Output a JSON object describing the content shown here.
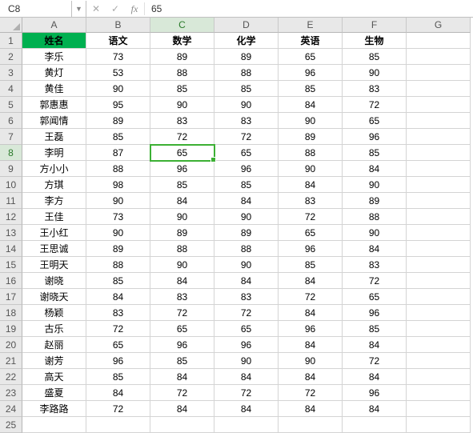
{
  "formula_bar": {
    "name_box": "C8",
    "cancel": "✕",
    "confirm": "✓",
    "fx": "fx",
    "value": "65"
  },
  "columns": [
    "A",
    "B",
    "C",
    "D",
    "E",
    "F",
    "G"
  ],
  "active_col_index": 2,
  "active_row_index": 7,
  "selected_cell": {
    "row": 7,
    "col": 2
  },
  "headers": [
    "姓名",
    "语文",
    "数学",
    "化学",
    "英语",
    "生物"
  ],
  "rows": [
    [
      "李乐",
      "73",
      "89",
      "89",
      "65",
      "85"
    ],
    [
      "黄灯",
      "53",
      "88",
      "88",
      "96",
      "90"
    ],
    [
      "黄佳",
      "90",
      "85",
      "85",
      "85",
      "83"
    ],
    [
      "郭惠惠",
      "95",
      "90",
      "90",
      "84",
      "72"
    ],
    [
      "郭闻情",
      "89",
      "83",
      "83",
      "90",
      "65"
    ],
    [
      "王磊",
      "85",
      "72",
      "72",
      "89",
      "96"
    ],
    [
      "李明",
      "87",
      "65",
      "65",
      "88",
      "85"
    ],
    [
      "方小小",
      "88",
      "96",
      "96",
      "90",
      "84"
    ],
    [
      "方琪",
      "98",
      "85",
      "85",
      "84",
      "90"
    ],
    [
      "李方",
      "90",
      "84",
      "84",
      "83",
      "89"
    ],
    [
      "王佳",
      "73",
      "90",
      "90",
      "72",
      "88"
    ],
    [
      "王小红",
      "90",
      "89",
      "89",
      "65",
      "90"
    ],
    [
      "王思诚",
      "89",
      "88",
      "88",
      "96",
      "84"
    ],
    [
      "王明天",
      "88",
      "90",
      "90",
      "85",
      "83"
    ],
    [
      "谢晓",
      "85",
      "84",
      "84",
      "84",
      "72"
    ],
    [
      "谢晓天",
      "84",
      "83",
      "83",
      "72",
      "65"
    ],
    [
      "杨颖",
      "83",
      "72",
      "72",
      "84",
      "96"
    ],
    [
      "古乐",
      "72",
      "65",
      "65",
      "96",
      "85"
    ],
    [
      "赵丽",
      "65",
      "96",
      "96",
      "84",
      "84"
    ],
    [
      "谢芳",
      "96",
      "85",
      "90",
      "90",
      "72"
    ],
    [
      "高天",
      "85",
      "84",
      "84",
      "84",
      "84"
    ],
    [
      "盛夏",
      "84",
      "72",
      "72",
      "72",
      "96"
    ],
    [
      "李路路",
      "72",
      "84",
      "84",
      "84",
      "84"
    ]
  ],
  "empty_rows": [
    25
  ],
  "chart_data": {
    "type": "table",
    "title": "",
    "columns": [
      "姓名",
      "语文",
      "数学",
      "化学",
      "英语",
      "生物"
    ],
    "data": [
      {
        "姓名": "李乐",
        "语文": 73,
        "数学": 89,
        "化学": 89,
        "英语": 65,
        "生物": 85
      },
      {
        "姓名": "黄灯",
        "语文": 53,
        "数学": 88,
        "化学": 88,
        "英语": 96,
        "生物": 90
      },
      {
        "姓名": "黄佳",
        "语文": 90,
        "数学": 85,
        "化学": 85,
        "英语": 85,
        "生物": 83
      },
      {
        "姓名": "郭惠惠",
        "语文": 95,
        "数学": 90,
        "化学": 90,
        "英语": 84,
        "生物": 72
      },
      {
        "姓名": "郭闻情",
        "语文": 89,
        "数学": 83,
        "化学": 83,
        "英语": 90,
        "生物": 65
      },
      {
        "姓名": "王磊",
        "语文": 85,
        "数学": 72,
        "化学": 72,
        "英语": 89,
        "生物": 96
      },
      {
        "姓名": "李明",
        "语文": 87,
        "数学": 65,
        "化学": 65,
        "英语": 88,
        "生物": 85
      },
      {
        "姓名": "方小小",
        "语文": 88,
        "数学": 96,
        "化学": 96,
        "英语": 90,
        "生物": 84
      },
      {
        "姓名": "方琪",
        "语文": 98,
        "数学": 85,
        "化学": 85,
        "英语": 84,
        "生物": 90
      },
      {
        "姓名": "李方",
        "语文": 90,
        "数学": 84,
        "化学": 84,
        "英语": 83,
        "生物": 89
      },
      {
        "姓名": "王佳",
        "语文": 73,
        "数学": 90,
        "化学": 90,
        "英语": 72,
        "生物": 88
      },
      {
        "姓名": "王小红",
        "语文": 90,
        "数学": 89,
        "化学": 89,
        "英语": 65,
        "生物": 90
      },
      {
        "姓名": "王思诚",
        "语文": 89,
        "数学": 88,
        "化学": 88,
        "英语": 96,
        "生物": 84
      },
      {
        "姓名": "王明天",
        "语文": 88,
        "数学": 90,
        "化学": 90,
        "英语": 85,
        "生物": 83
      },
      {
        "姓名": "谢晓",
        "语文": 85,
        "数学": 84,
        "化学": 84,
        "英语": 84,
        "生物": 72
      },
      {
        "姓名": "谢晓天",
        "语文": 84,
        "数学": 83,
        "化学": 83,
        "英语": 72,
        "生物": 65
      },
      {
        "姓名": "杨颖",
        "语文": 83,
        "数学": 72,
        "化学": 72,
        "英语": 84,
        "生物": 96
      },
      {
        "姓名": "古乐",
        "语文": 72,
        "数学": 65,
        "化学": 65,
        "英语": 96,
        "生物": 85
      },
      {
        "姓名": "赵丽",
        "语文": 65,
        "数学": 96,
        "化学": 96,
        "英语": 84,
        "生物": 84
      },
      {
        "姓名": "谢芳",
        "语文": 96,
        "数学": 85,
        "化学": 90,
        "英语": 90,
        "生物": 72
      },
      {
        "姓名": "高天",
        "语文": 85,
        "数学": 84,
        "化学": 84,
        "英语": 84,
        "生物": 84
      },
      {
        "姓名": "盛夏",
        "语文": 84,
        "数学": 72,
        "化学": 72,
        "英语": 72,
        "生物": 96
      },
      {
        "姓名": "李路路",
        "语文": 72,
        "数学": 84,
        "化学": 84,
        "英语": 84,
        "生物": 84
      }
    ]
  }
}
